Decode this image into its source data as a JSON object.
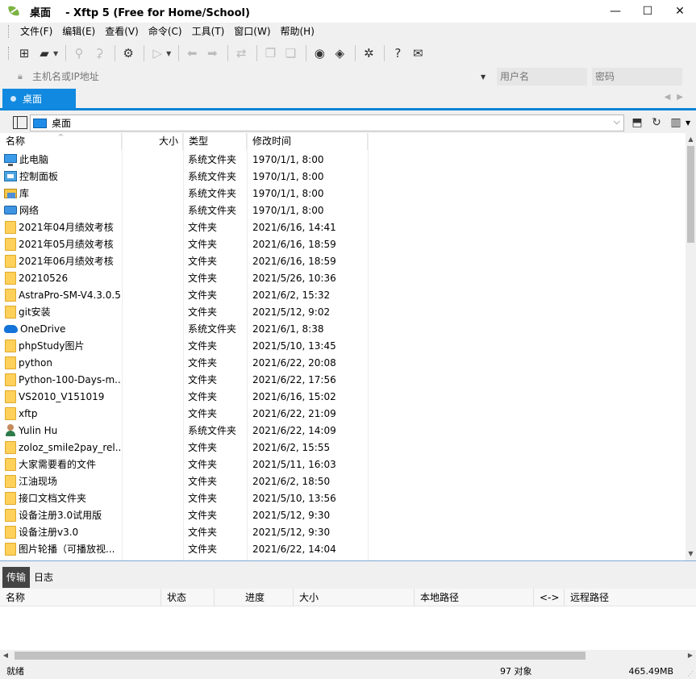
{
  "window": {
    "title": "桌面    - Xftp 5 (Free for Home/School)",
    "minimize": "—",
    "maximize": "☐",
    "close": "✕"
  },
  "menu": [
    "文件(F)",
    "编辑(E)",
    "查看(V)",
    "命令(C)",
    "工具(T)",
    "窗口(W)",
    "帮助(H)"
  ],
  "connect": {
    "host_placeholder": "主机名或IP地址",
    "user_placeholder": "用户名",
    "password_placeholder": "密码"
  },
  "tab": {
    "label": "桌面"
  },
  "path": {
    "current": "桌面"
  },
  "columns": {
    "name": "名称",
    "size": "大小",
    "type": "类型",
    "modified": "修改时间"
  },
  "files": [
    {
      "name": "此电脑",
      "type": "系统文件夹",
      "modified": "1970/1/1, 8:00",
      "icon": "computer-icon"
    },
    {
      "name": "控制面板",
      "type": "系统文件夹",
      "modified": "1970/1/1, 8:00",
      "icon": "control-panel-icon"
    },
    {
      "name": "库",
      "type": "系统文件夹",
      "modified": "1970/1/1, 8:00",
      "icon": "library-icon"
    },
    {
      "name": "网络",
      "type": "系统文件夹",
      "modified": "1970/1/1, 8:00",
      "icon": "network-icon"
    },
    {
      "name": "2021年04月绩效考核",
      "type": "文件夹",
      "modified": "2021/6/16, 14:41",
      "icon": "folder-icon"
    },
    {
      "name": "2021年05月绩效考核",
      "type": "文件夹",
      "modified": "2021/6/16, 18:59",
      "icon": "folder-icon"
    },
    {
      "name": "2021年06月绩效考核",
      "type": "文件夹",
      "modified": "2021/6/16, 18:59",
      "icon": "folder-icon"
    },
    {
      "name": "20210526",
      "type": "文件夹",
      "modified": "2021/5/26, 10:36",
      "icon": "folder-icon"
    },
    {
      "name": "AstraPro-SM-V4.3.0.5",
      "type": "文件夹",
      "modified": "2021/6/2, 15:32",
      "icon": "folder-icon"
    },
    {
      "name": "git安装",
      "type": "文件夹",
      "modified": "2021/5/12, 9:02",
      "icon": "folder-icon"
    },
    {
      "name": "OneDrive",
      "type": "系统文件夹",
      "modified": "2021/6/1, 8:38",
      "icon": "onedrive-cloud-icon"
    },
    {
      "name": "phpStudy图片",
      "type": "文件夹",
      "modified": "2021/5/10, 13:45",
      "icon": "folder-icon"
    },
    {
      "name": "python",
      "type": "文件夹",
      "modified": "2021/6/22, 20:08",
      "icon": "folder-icon"
    },
    {
      "name": "Python-100-Days-m...",
      "type": "文件夹",
      "modified": "2021/6/22, 17:56",
      "icon": "folder-icon"
    },
    {
      "name": "VS2010_V151019",
      "type": "文件夹",
      "modified": "2021/6/16, 15:02",
      "icon": "folder-icon"
    },
    {
      "name": "xftp",
      "type": "文件夹",
      "modified": "2021/6/22, 21:09",
      "icon": "folder-icon"
    },
    {
      "name": "Yulin Hu",
      "type": "系统文件夹",
      "modified": "2021/6/22, 14:09",
      "icon": "user-icon"
    },
    {
      "name": "zoloz_smile2pay_rel...",
      "type": "文件夹",
      "modified": "2021/6/2, 15:55",
      "icon": "folder-icon"
    },
    {
      "name": "大家需要看的文件",
      "type": "文件夹",
      "modified": "2021/5/11, 16:03",
      "icon": "folder-icon"
    },
    {
      "name": "江油现场",
      "type": "文件夹",
      "modified": "2021/6/2, 18:50",
      "icon": "folder-icon"
    },
    {
      "name": "接口文档文件夹",
      "type": "文件夹",
      "modified": "2021/5/10, 13:56",
      "icon": "folder-icon"
    },
    {
      "name": "设备注册3.0试用版",
      "type": "文件夹",
      "modified": "2021/5/12, 9:30",
      "icon": "folder-icon"
    },
    {
      "name": "设备注册v3.0",
      "type": "文件夹",
      "modified": "2021/5/12, 9:30",
      "icon": "folder-icon"
    },
    {
      "name": "图片轮播（可播放视...",
      "type": "文件夹",
      "modified": "2021/6/22, 14:04",
      "icon": "folder-icon"
    }
  ],
  "bottom_tabs": [
    "传输",
    "日志"
  ],
  "transfer_columns": [
    "名称",
    "状态",
    "进度",
    "大小",
    "本地路径",
    "<->",
    "远程路径"
  ],
  "status": {
    "left": "就绪",
    "count": "97 对象",
    "size": "465.49MB"
  }
}
